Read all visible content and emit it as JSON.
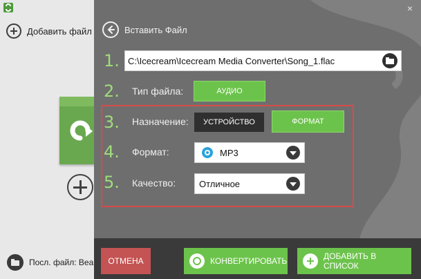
{
  "left_panel": {
    "add_file_label": "Добавить файл",
    "last_file_label": "Посл. файл: Bea"
  },
  "dialog": {
    "close_icon": "×",
    "back_title": "Вставить Файл",
    "steps": [
      "1.",
      "2.",
      "3.",
      "4.",
      "5."
    ],
    "path_value": "C:\\Icecream\\Icecream Media Converter\\Song_1.flac",
    "file_type_label": "Тип файла:",
    "file_type_value": "АУДИО",
    "destination_label": "Назначение:",
    "destination_options": [
      "УСТРОЙСТВО",
      "ФОРМАТ"
    ],
    "format_label": "Формат:",
    "format_value": "MP3",
    "quality_label": "Качество:",
    "quality_value": "Отличное"
  },
  "bottom": {
    "cancel": "ОТМЕНА",
    "convert": "КОНВЕРТИРОВАТЬ",
    "add_to_list": "ДОБАВИТЬ В СПИСОК"
  },
  "colors": {
    "accent_green": "#6cc34b",
    "step_number_green": "#9fdc7a",
    "cancel_red": "#c45353",
    "highlight_red": "#d94a4a",
    "dialog_bg": "#6e6e6e"
  }
}
